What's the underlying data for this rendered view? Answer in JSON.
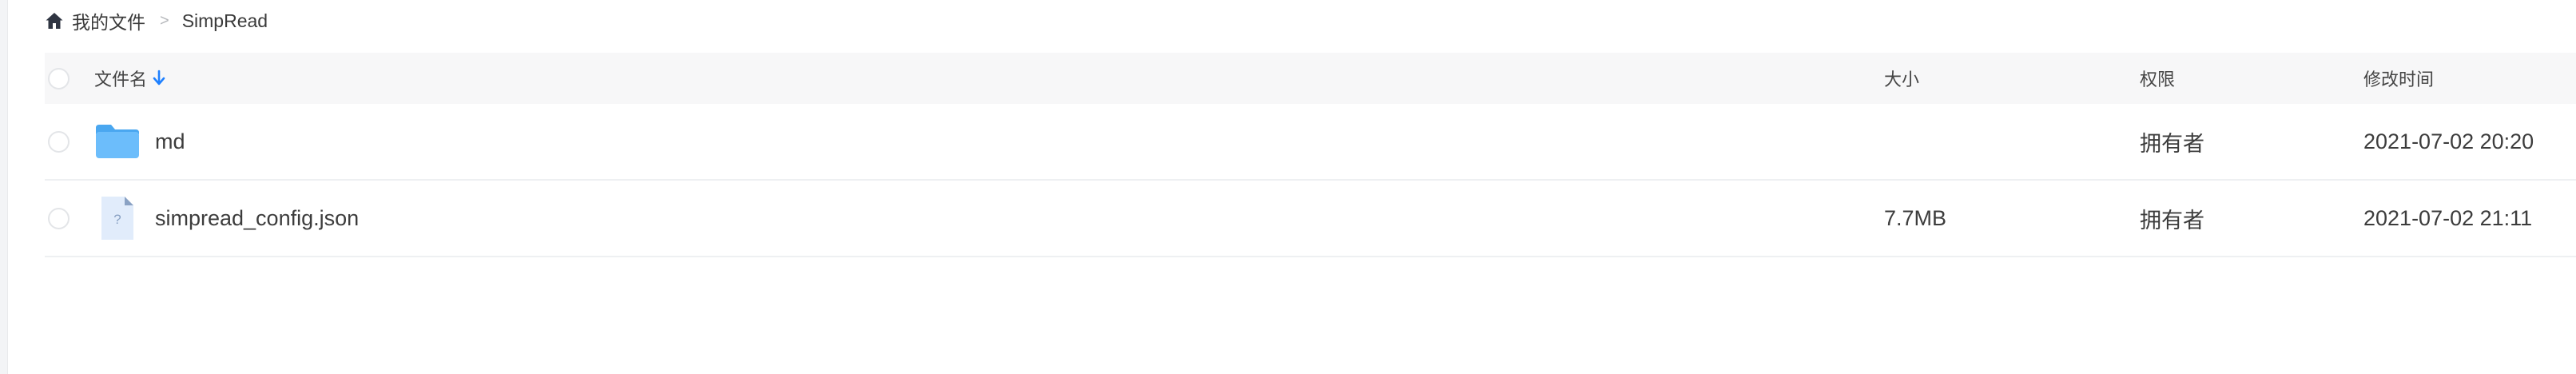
{
  "breadcrumb": {
    "home_icon": "home-icon",
    "root_label": "我的文件",
    "separator": ">",
    "current_label": "SimpRead"
  },
  "table": {
    "columns": {
      "name": "文件名",
      "size": "大小",
      "permission": "权限",
      "modified": "修改时间"
    },
    "sort_icon": "arrow-down-icon",
    "sort_color": "#1e80ff",
    "rows": [
      {
        "icon": "folder-icon",
        "name": "md",
        "size": "",
        "permission": "拥有者",
        "modified": "2021-07-02 20:20"
      },
      {
        "icon": "unknown-file-icon",
        "icon_glyph": "?",
        "name": "simpread_config.json",
        "size": "7.7MB",
        "permission": "拥有者",
        "modified": "2021-07-02 21:11"
      }
    ]
  },
  "colors": {
    "folder": "#6cbdfb",
    "folder_tab": "#4aa7f0",
    "file_icon": "#e1ecfb"
  }
}
